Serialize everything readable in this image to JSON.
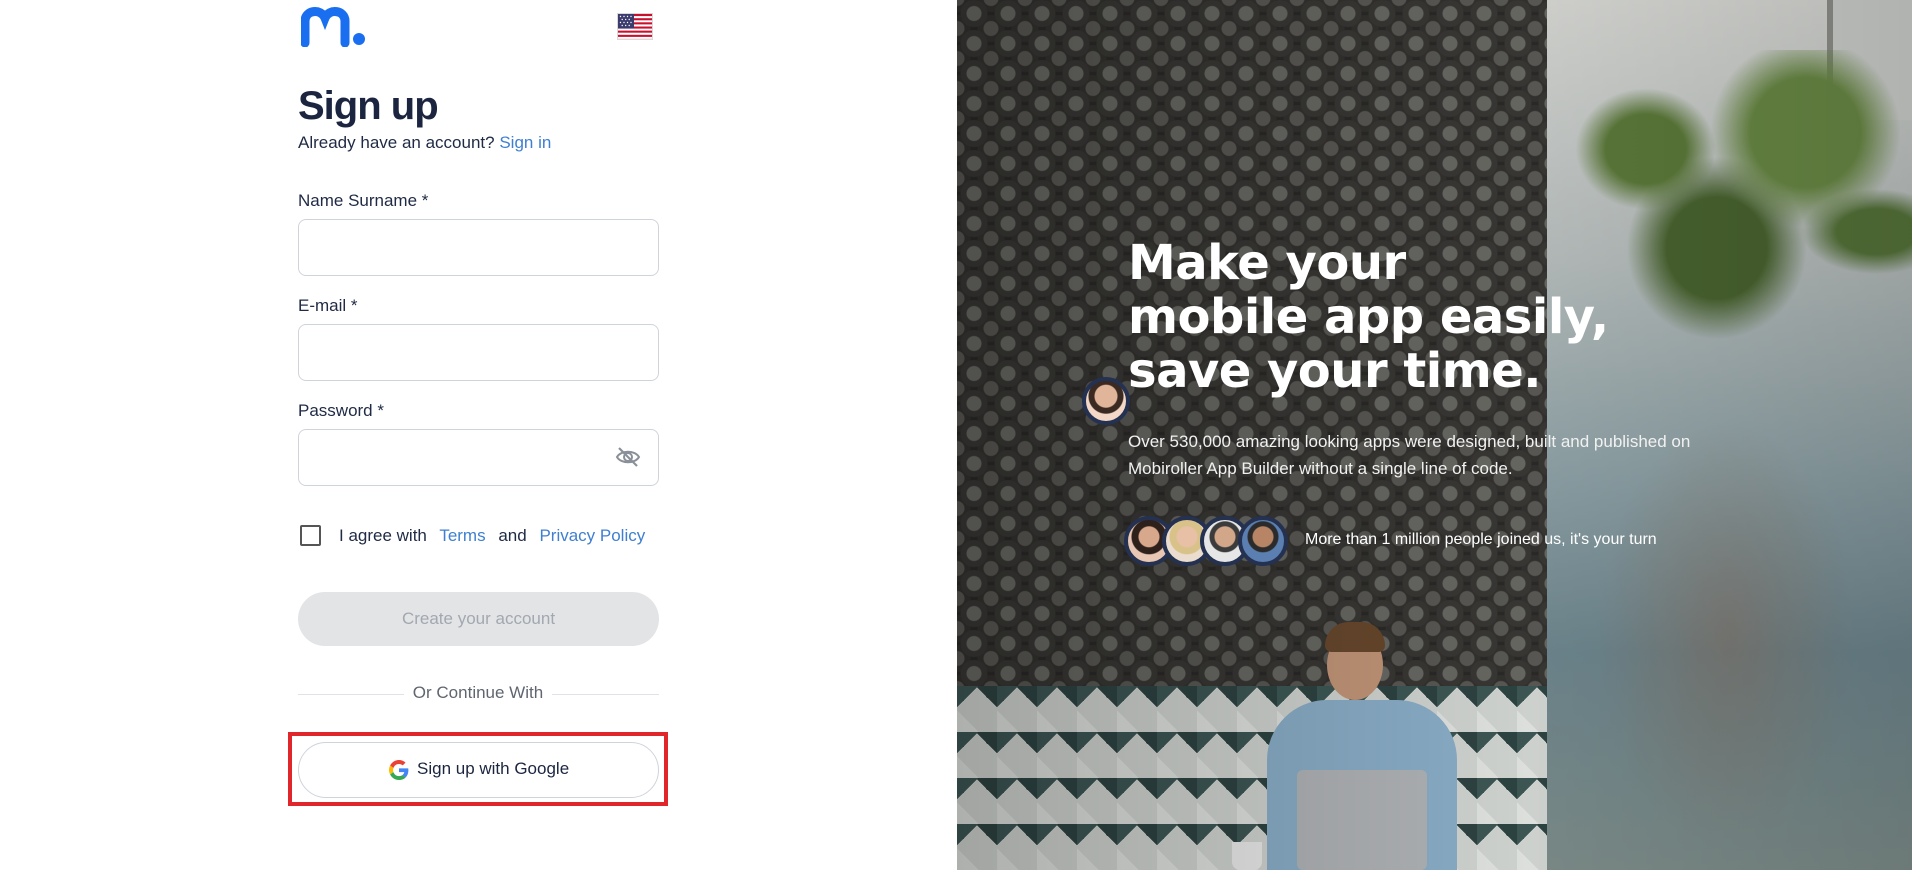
{
  "brand": {
    "logo_icon": "mobiroller-logo-icon",
    "language_flag": "us-flag-icon"
  },
  "signup": {
    "title": "Sign up",
    "have_account_text": "Already have an account?",
    "signin_link": "Sign in"
  },
  "form": {
    "name_label": "Name Surname *",
    "name_value": "",
    "email_label": "E-mail *",
    "email_value": "",
    "password_label": "Password *",
    "password_value": "",
    "password_toggle_icon": "eye-slash-icon",
    "agree_prefix": "I agree with",
    "terms_link": "Terms",
    "and_text": "and",
    "privacy_link": "Privacy Policy",
    "agree_checked": false,
    "create_button": "Create your account"
  },
  "divider": {
    "text": "Or Continue With"
  },
  "google": {
    "icon": "google-icon",
    "label": "Sign up with Google"
  },
  "hero": {
    "headline_line1": "Make your",
    "headline_line2": "mobile app easily,",
    "headline_line3": "save your time.",
    "subtext": "Over 530,000 amazing looking apps were designed, built and published on Mobiroller App Builder without a single line of code.",
    "joined_text": "More than 1 million people joined us, it's your turn"
  },
  "colors": {
    "link": "#3f7fd1",
    "highlight": "#e0252b",
    "logo_blue": "#1a6ff0",
    "disabled_button": "#e3e4e6"
  }
}
